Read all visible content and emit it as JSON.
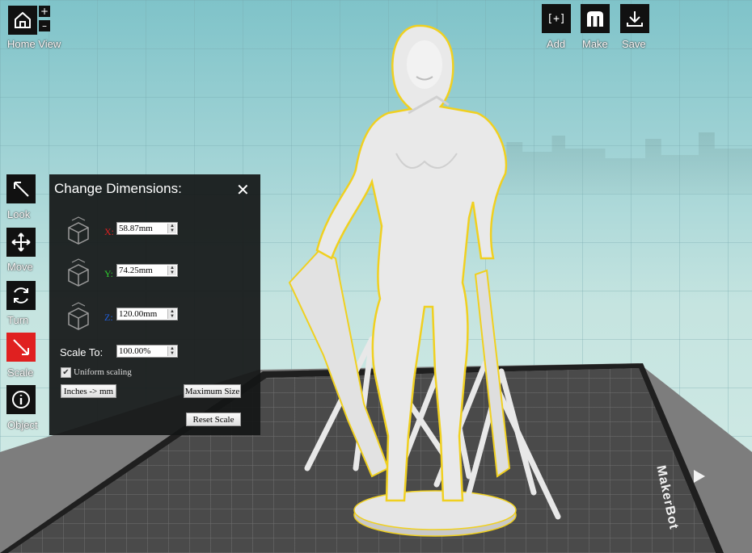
{
  "toolbar_top_left": {
    "home_label": "Home View",
    "zoom_in": "+",
    "zoom_out": "–"
  },
  "toolbar_top_right": {
    "add": {
      "label": "Add",
      "icon": "[+]"
    },
    "make": {
      "label": "Make"
    },
    "save": {
      "label": "Save"
    }
  },
  "left_tools": [
    {
      "label": "Look",
      "icon": "look-arrow-icon"
    },
    {
      "label": "Move",
      "icon": "move-arrows-icon"
    },
    {
      "label": "Turn",
      "icon": "rotate-icon"
    },
    {
      "label": "Scale",
      "icon": "scale-arrow-icon",
      "active": true
    },
    {
      "label": "Object",
      "icon": "info-icon"
    }
  ],
  "panel": {
    "title": "Change Dimensions:",
    "close": "✕",
    "dims": [
      {
        "axis": "X:",
        "value": "58.87mm",
        "color": "#e02020"
      },
      {
        "axis": "Y:",
        "value": "74.25mm",
        "color": "#2ec82e"
      },
      {
        "axis": "Z:",
        "value": "120.00mm",
        "color": "#2060e0"
      }
    ],
    "scale_label": "Scale To:",
    "scale_value": "100.00%",
    "uniform_label": "Uniform scaling",
    "uniform_checked": true,
    "inches_button": "Inches -> mm",
    "max_button": "Maximum Size",
    "reset_button": "Reset Scale"
  },
  "brand": "MakerBot",
  "colors": {
    "active_tool": "#e02020",
    "selection_outline": "#f0d020"
  }
}
